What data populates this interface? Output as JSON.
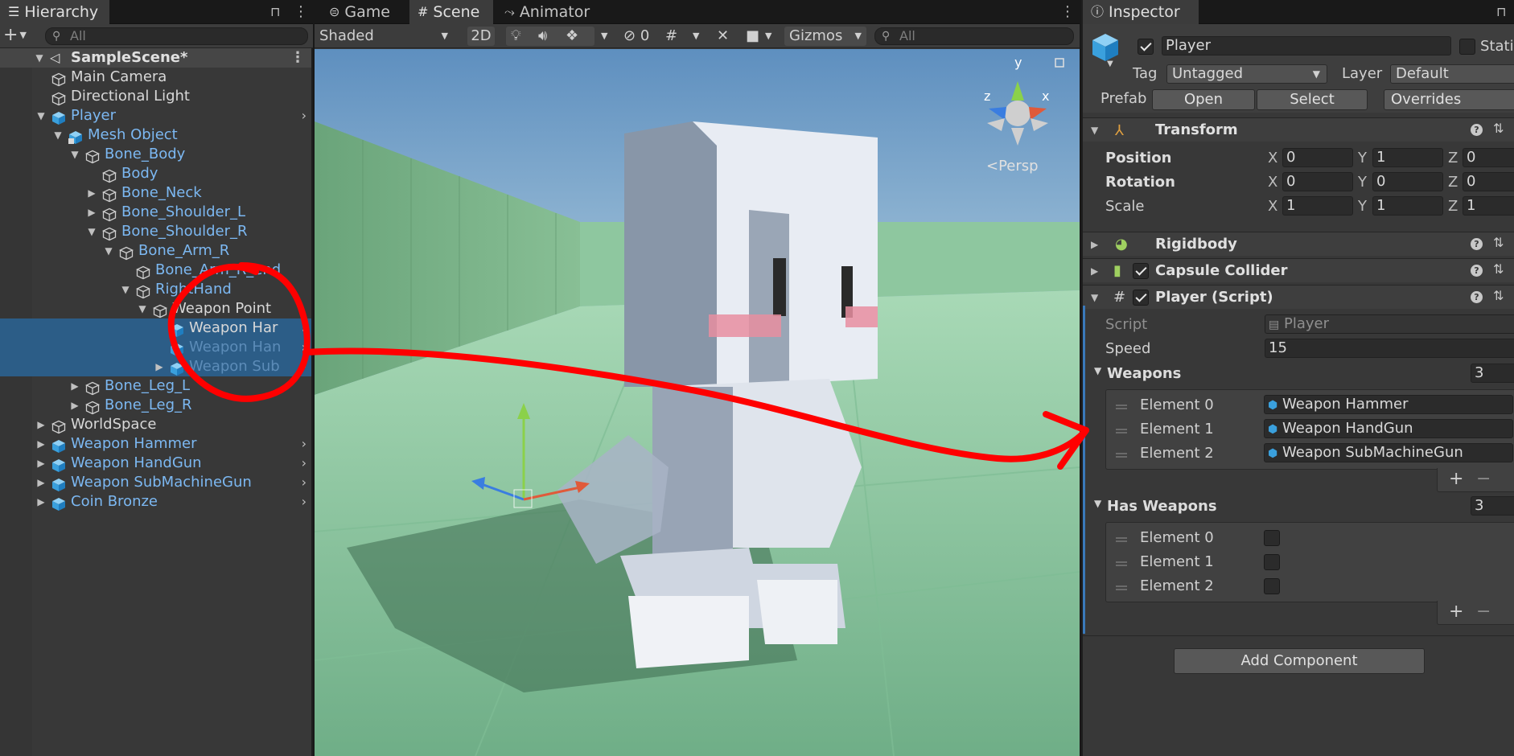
{
  "hierarchy": {
    "tab_label": "Hierarchy",
    "search_placeholder": "All",
    "scene_name": "SampleScene*",
    "items": [
      {
        "label": "Main Camera"
      },
      {
        "label": "Directional Light"
      },
      {
        "label": "Player"
      },
      {
        "label": "Mesh Object"
      },
      {
        "label": "Bone_Body"
      },
      {
        "label": "Body"
      },
      {
        "label": "Bone_Neck"
      },
      {
        "label": "Bone_Shoulder_L"
      },
      {
        "label": "Bone_Shoulder_R"
      },
      {
        "label": "Bone_Arm_R"
      },
      {
        "label": "Bone_Arm_R_end"
      },
      {
        "label": "RightHand"
      },
      {
        "label": "Weapon Point"
      },
      {
        "label": "Weapon Har"
      },
      {
        "label": "Weapon Han"
      },
      {
        "label": "Weapon Sub"
      },
      {
        "label": "Bone_Leg_L"
      },
      {
        "label": "Bone_Leg_R"
      },
      {
        "label": "WorldSpace"
      },
      {
        "label": "Weapon Hammer"
      },
      {
        "label": "Weapon HandGun"
      },
      {
        "label": "Weapon SubMachineGun"
      },
      {
        "label": "Coin Bronze"
      }
    ]
  },
  "scene_view": {
    "tabs": [
      {
        "label": "Game"
      },
      {
        "label": "Scene"
      },
      {
        "label": "Animator"
      }
    ],
    "draw_mode": "Shaded",
    "btn_2d": "2D",
    "hidden_count": "0",
    "gizmos_label": "Gizmos",
    "search_placeholder": "All",
    "persp_label": "<Persp",
    "axis_x": "x",
    "axis_y": "y",
    "axis_z": "z"
  },
  "inspector": {
    "tab_label": "Inspector",
    "object_name": "Player",
    "static_label": "Static",
    "tag_label": "Tag",
    "tag_value": "Untagged",
    "layer_label": "Layer",
    "layer_value": "Default",
    "prefab_label": "Prefab",
    "prefab_open": "Open",
    "prefab_select": "Select",
    "prefab_overrides": "Overrides",
    "transform": {
      "title": "Transform",
      "position_label": "Position",
      "rotation_label": "Rotation",
      "scale_label": "Scale",
      "position": {
        "x": "0",
        "y": "1",
        "z": "0"
      },
      "rotation": {
        "x": "0",
        "y": "0",
        "z": "0"
      },
      "scale": {
        "x": "1",
        "y": "1",
        "z": "1"
      }
    },
    "rigidbody_title": "Rigidbody",
    "capsule_title": "Capsule Collider",
    "script": {
      "title": "Player (Script)",
      "script_label": "Script",
      "script_value": "Player",
      "speed_label": "Speed",
      "speed_value": "15",
      "weapons_label": "Weapons",
      "weapons_count": "3",
      "weapons": [
        {
          "label": "Element 0",
          "value": "Weapon Hammer"
        },
        {
          "label": "Element 1",
          "value": "Weapon HandGun"
        },
        {
          "label": "Element 2",
          "value": "Weapon SubMachineGun"
        }
      ],
      "has_weapons_label": "Has Weapons",
      "has_weapons_count": "3",
      "has_weapons": [
        {
          "label": "Element 0",
          "checked": false
        },
        {
          "label": "Element 1",
          "checked": false
        },
        {
          "label": "Element 2",
          "checked": false
        }
      ]
    },
    "add_component": "Add Component"
  },
  "axis_labels": {
    "x": "X",
    "y": "Y",
    "z": "Z"
  },
  "colors": {
    "selection": "#2c5d87",
    "prefab_blue": "#7cb8f2",
    "annotation_red": "#ff0000",
    "ground_green": "#8fc7a2"
  }
}
